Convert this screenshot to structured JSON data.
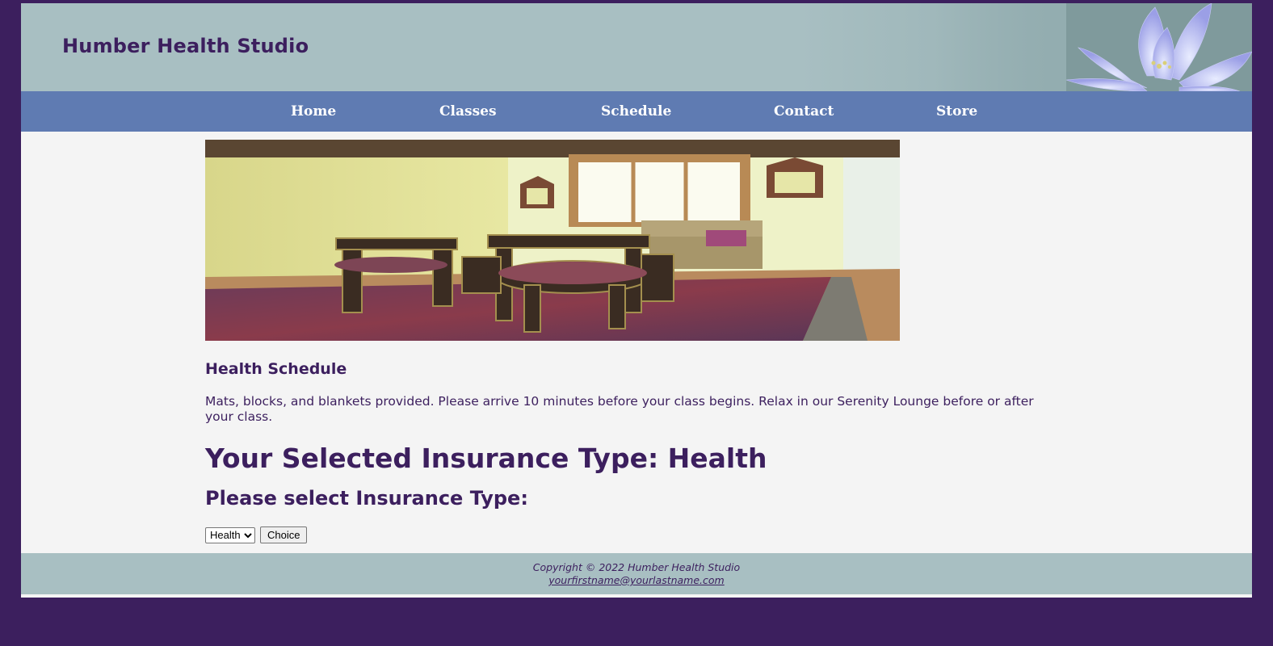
{
  "header": {
    "title": "Humber Health Studio"
  },
  "nav": {
    "items": [
      {
        "label": "Home"
      },
      {
        "label": "Classes"
      },
      {
        "label": "Schedule"
      },
      {
        "label": "Contact"
      },
      {
        "label": "Store"
      }
    ]
  },
  "main": {
    "schedule_title": "Health Schedule",
    "intro": "Mats, blocks, and blankets provided. Please arrive 10 minutes before your class begins. Relax in our Serenity Lounge before or after your class.",
    "selected_heading": "Your Selected Insurance Type: Health",
    "select_heading": "Please select Insurance Type:",
    "insurance_select": {
      "selected": "Health"
    },
    "choice_button": "Choice"
  },
  "footer": {
    "copyright": "Copyright © 2022 Humber Health Studio",
    "email": "yourfirstname@yourlastname.com"
  },
  "colors": {
    "page_background": "#3c1f5e",
    "header_background": "#a8bfc2",
    "nav_background": "#5f7bb2",
    "content_background": "#f4f4f4",
    "text": "#3c1f5e"
  }
}
